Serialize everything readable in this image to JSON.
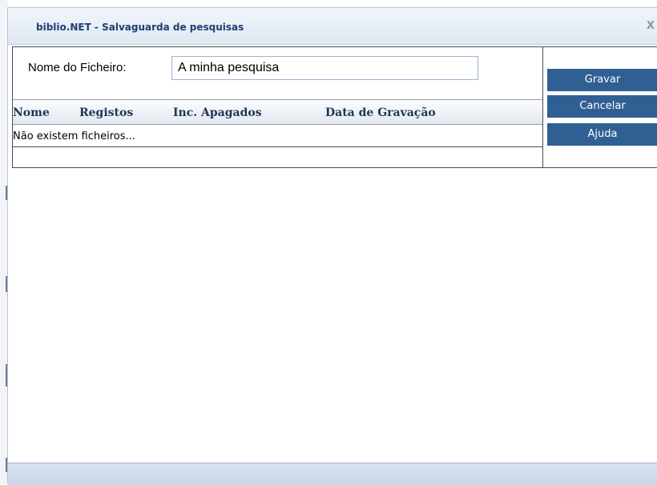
{
  "dialog": {
    "title": "biblio.NET - Salvaguarda de pesquisas",
    "close_label": "X"
  },
  "form": {
    "filename_label": "Nome do Ficheiro:",
    "filename_value": "A minha pesquisa"
  },
  "table": {
    "columns": [
      "Nome",
      "Registos",
      "Inc. Apagados",
      "Data de Gravação"
    ],
    "empty_message": "Não existem ficheiros..."
  },
  "buttons": {
    "save": "Gravar",
    "cancel": "Cancelar",
    "help": "Ajuda"
  }
}
